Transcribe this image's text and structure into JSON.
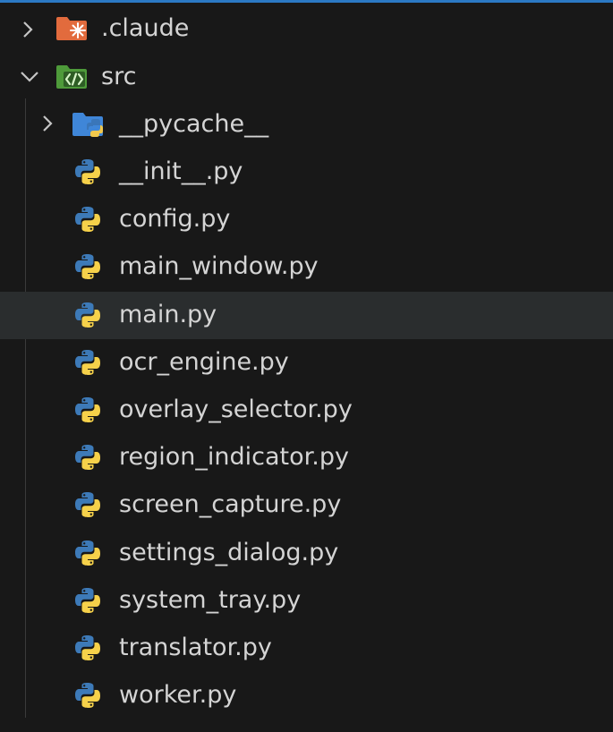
{
  "explorer": {
    "accent": "#2b79c4",
    "folders": [
      {
        "label": ".claude",
        "state": "collapsed",
        "icon": "claude-folder-icon"
      },
      {
        "label": "src",
        "state": "expanded",
        "icon": "source-folder-icon"
      }
    ],
    "subfolder": {
      "label": "__pycache__",
      "state": "collapsed",
      "icon": "python-folder-icon"
    },
    "files": [
      {
        "label": "__init__.py",
        "icon": "python-file-icon"
      },
      {
        "label": "config.py",
        "icon": "python-file-icon"
      },
      {
        "label": "main_window.py",
        "icon": "python-file-icon"
      },
      {
        "label": "main.py",
        "icon": "python-file-icon",
        "selected": true
      },
      {
        "label": "ocr_engine.py",
        "icon": "python-file-icon"
      },
      {
        "label": "overlay_selector.py",
        "icon": "python-file-icon"
      },
      {
        "label": "region_indicator.py",
        "icon": "python-file-icon"
      },
      {
        "label": "screen_capture.py",
        "icon": "python-file-icon"
      },
      {
        "label": "settings_dialog.py",
        "icon": "python-file-icon"
      },
      {
        "label": "system_tray.py",
        "icon": "python-file-icon"
      },
      {
        "label": "translator.py",
        "icon": "python-file-icon"
      },
      {
        "label": "worker.py",
        "icon": "python-file-icon"
      }
    ]
  }
}
